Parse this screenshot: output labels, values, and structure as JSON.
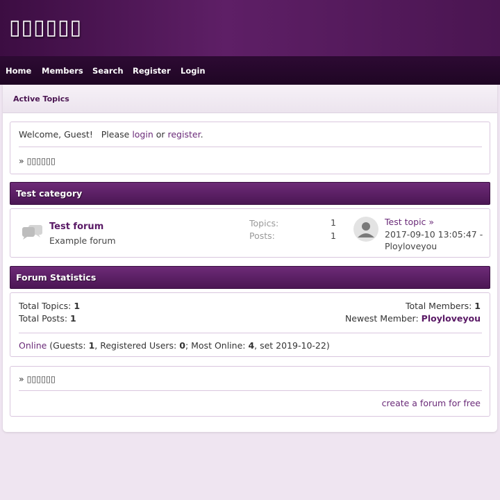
{
  "site": {
    "title": "▯▯▯▯▯▯"
  },
  "nav": {
    "items": [
      "Home",
      "Members",
      "Search",
      "Register",
      "Login"
    ]
  },
  "breadcrumb": {
    "label": "Active Topics"
  },
  "welcome": {
    "prefix": "Welcome, Guest!   Please ",
    "login": "login",
    "or": " or ",
    "register": "register",
    "dot": ".",
    "board_link": "» ▯▯▯▯▯▯"
  },
  "category": {
    "title": "Test category",
    "forum": {
      "name": "Test forum",
      "description": "Example forum",
      "topics_label": "Topics:",
      "topics_value": "1",
      "posts_label": "Posts:",
      "posts_value": "1",
      "last_post": {
        "topic": "Test topic",
        "arrow": "»",
        "date": "2017-09-10 13:05:47 -",
        "author": "Ployloveyou"
      }
    }
  },
  "stats": {
    "title": "Forum Statistics",
    "total_topics_label": "Total Topics: ",
    "total_topics_value": "1",
    "total_posts_label": "Total Posts: ",
    "total_posts_value": "1",
    "total_members_label": "Total Members: ",
    "total_members_value": "1",
    "newest_member_label": "Newest Member: ",
    "newest_member_value": "Ployloveyou",
    "online_link": "Online",
    "guests_label": " (Guests: ",
    "guests_value": "1",
    "registered_label": ", Registered Users: ",
    "registered_value": "0",
    "most_online_label": "; Most Online: ",
    "most_online_value": "4",
    "set_text": ", set 2019-10-22)"
  },
  "footer": {
    "board_link": "» ▯▯▯▯▯▯",
    "create_link": "create a forum for free"
  },
  "colors": {
    "accent": "#5e1f66",
    "link": "#6a2a78",
    "background": "#efe5f1"
  }
}
